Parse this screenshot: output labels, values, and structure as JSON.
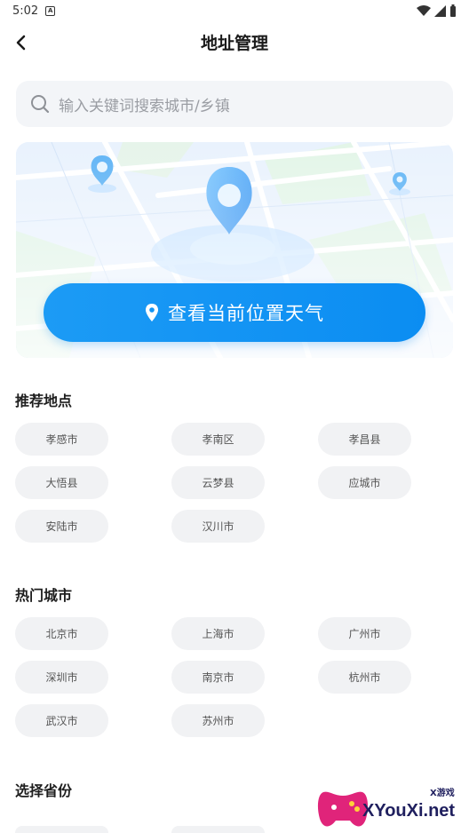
{
  "status_bar": {
    "time": "5:02"
  },
  "header": {
    "title": "地址管理"
  },
  "search": {
    "placeholder": "输入关键词搜索城市/乡镇"
  },
  "location_button": {
    "label": "查看当前位置天气"
  },
  "sections": {
    "recommended": {
      "title": "推荐地点",
      "items": [
        "孝感市",
        "孝南区",
        "孝昌县",
        "大悟县",
        "云梦县",
        "应城市",
        "安陆市",
        "汉川市"
      ]
    },
    "hot": {
      "title": "热门城市",
      "items": [
        "北京市",
        "上海市",
        "广州市",
        "深圳市",
        "南京市",
        "杭州市",
        "武汉市",
        "苏州市"
      ]
    },
    "province": {
      "title": "选择省份"
    }
  },
  "watermark": {
    "text": "XYouXi.net",
    "small": "X游戏"
  },
  "colors": {
    "accent": "#0b8df2",
    "chip_bg": "#f1f2f4",
    "search_bg": "#f3f5f8"
  }
}
